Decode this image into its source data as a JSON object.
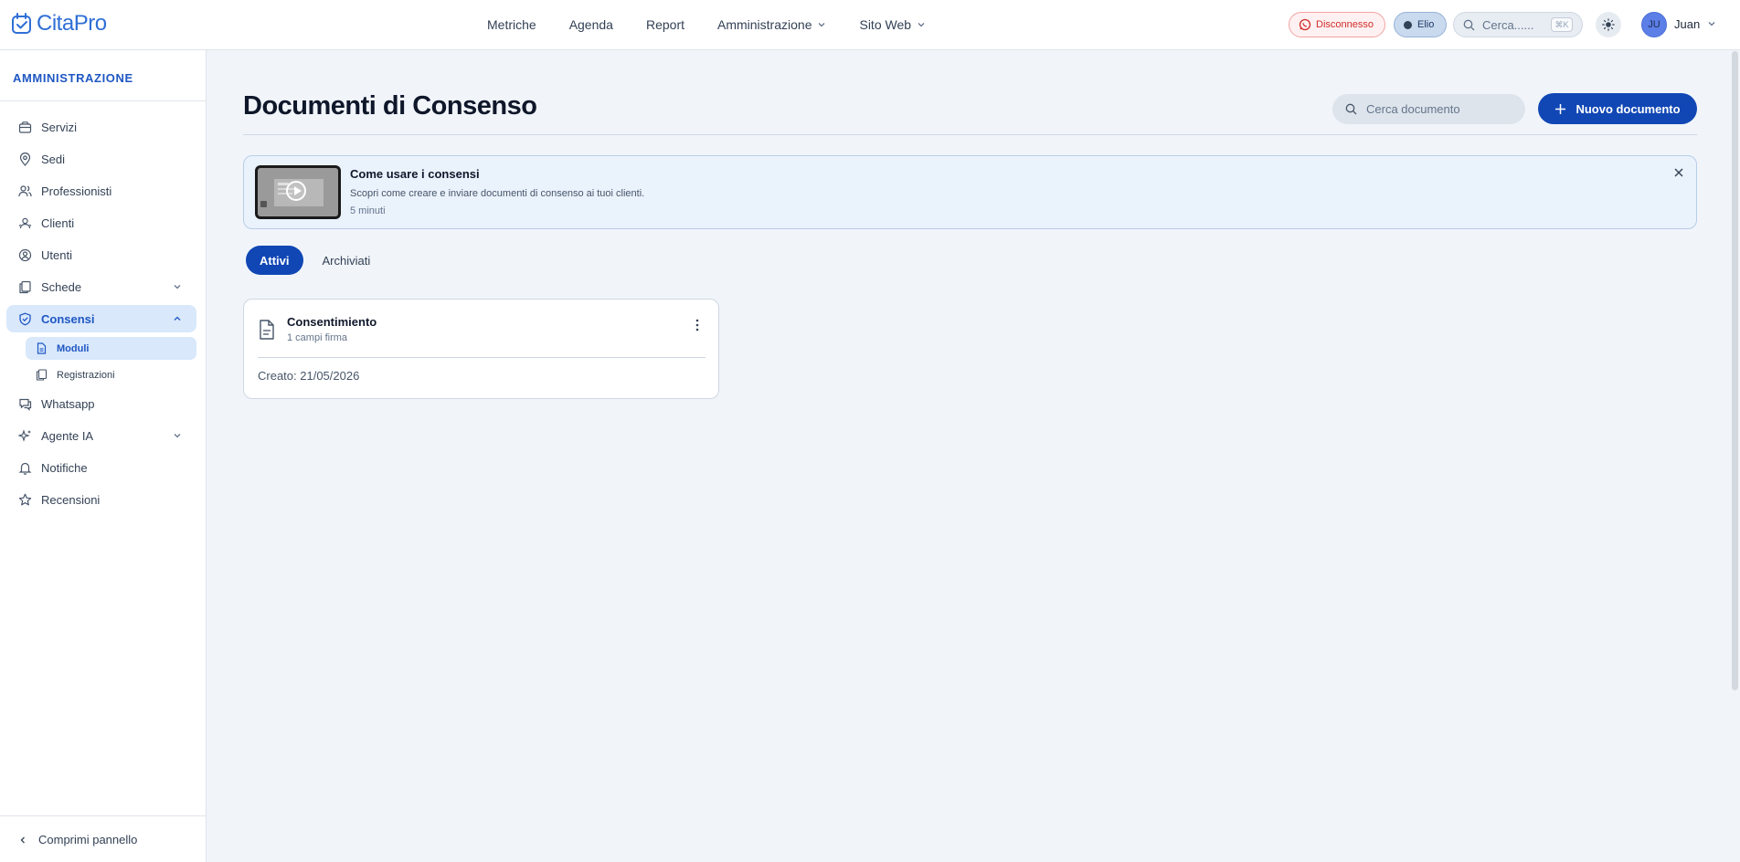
{
  "brand": {
    "name_part1": "Cita",
    "name_part2": "Pro",
    "color": "#2f6fd6"
  },
  "nav": {
    "items": [
      {
        "label": "Metriche",
        "has_dropdown": false
      },
      {
        "label": "Agenda",
        "has_dropdown": false
      },
      {
        "label": "Report",
        "has_dropdown": false
      },
      {
        "label": "Amministrazione",
        "has_dropdown": true
      },
      {
        "label": "Sito Web",
        "has_dropdown": true
      }
    ]
  },
  "topbar": {
    "whatsapp_status": "Disconnesso",
    "agent_name": "Elio",
    "search_placeholder": "Cerca......",
    "search_shortcut": "⌘K",
    "user_initials": "JU",
    "user_name": "Juan"
  },
  "sidebar": {
    "title": "AMMINISTRAZIONE",
    "items": [
      {
        "label": "Servizi",
        "icon": "box-icon"
      },
      {
        "label": "Sedi",
        "icon": "map-pin-icon"
      },
      {
        "label": "Professionisti",
        "icon": "users-icon"
      },
      {
        "label": "Clienti",
        "icon": "clients-icon"
      },
      {
        "label": "Utenti",
        "icon": "user-circle-icon"
      },
      {
        "label": "Schede",
        "icon": "files-icon",
        "expandable": true
      },
      {
        "label": "Consensi",
        "icon": "shield-check-icon",
        "expanded": true,
        "active": true
      },
      {
        "label": "Whatsapp",
        "icon": "chat-icon"
      },
      {
        "label": "Agente IA",
        "icon": "sparkles-icon",
        "expandable": true
      },
      {
        "label": "Notifiche",
        "icon": "bell-icon"
      },
      {
        "label": "Recensioni",
        "icon": "star-icon"
      }
    ],
    "consensi_sub": [
      {
        "label": "Moduli",
        "active": true
      },
      {
        "label": "Registrazioni",
        "active": false
      }
    ],
    "collapse_label": "Comprimi pannello"
  },
  "main": {
    "title": "Documenti di Consenso",
    "search_placeholder": "Cerca documento",
    "new_button_label": "Nuovo documento",
    "banner": {
      "title": "Come usare i consensi",
      "description": "Scopri come creare e inviare documenti di consenso ai tuoi clienti.",
      "duration": "5 minuti"
    },
    "tabs": [
      {
        "label": "Attivi",
        "active": true
      },
      {
        "label": "Archiviati",
        "active": false
      }
    ],
    "documents": [
      {
        "title": "Consentimiento",
        "subtitle": "1 campi firma",
        "created": "Creato: 21/05/2026"
      }
    ]
  },
  "colors": {
    "primary": "#1147b5",
    "active_bg": "#d9e8fb",
    "danger": "#d12c2c",
    "page_bg": "#f1f5fa"
  }
}
